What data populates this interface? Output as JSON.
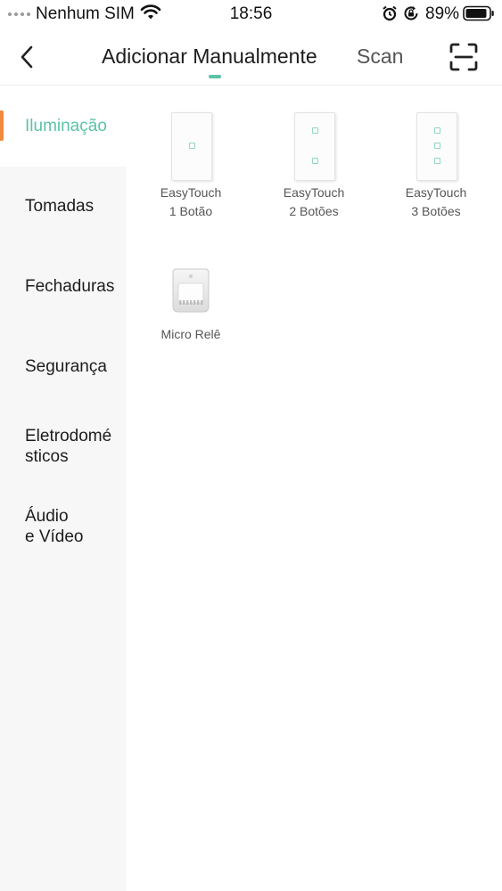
{
  "status_bar": {
    "carrier": "Nenhum SIM",
    "time": "18:56",
    "battery": "89%"
  },
  "nav": {
    "tab_manual": "Adicionar Manualmente",
    "tab_scan": "Scan",
    "accent": "#5cc3a6"
  },
  "sidebar": {
    "items": [
      {
        "label": "Iluminação"
      },
      {
        "label": "Tomadas"
      },
      {
        "label": "Fechaduras"
      },
      {
        "label": "Segurança"
      },
      {
        "label": "Eletrodomé\nsticos"
      },
      {
        "label": "Áudio\ne Vídeo"
      }
    ],
    "active_color": "#5cc3a6",
    "indicator_color": "#f08a3c"
  },
  "devices": [
    {
      "label": "EasyTouch\n1 Botão",
      "buttons": 1
    },
    {
      "label": "EasyTouch\n2 Botões",
      "buttons": 2
    },
    {
      "label": "EasyTouch\n3 Botões",
      "buttons": 3
    },
    {
      "label": "Micro Relê"
    }
  ]
}
